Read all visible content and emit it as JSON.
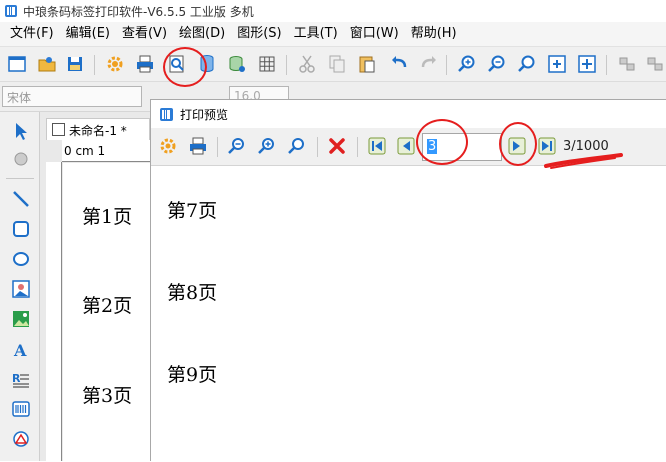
{
  "window": {
    "title": "中琅条码标签打印软件-V6.5.5 工业版 多机"
  },
  "menu": [
    "文件(F)",
    "编辑(E)",
    "查看(V)",
    "绘图(D)",
    "图形(S)",
    "工具(T)",
    "窗口(W)",
    "帮助(H)"
  ],
  "format_toolbar": {
    "font": "宋体",
    "size": "16.0"
  },
  "document": {
    "tab_label": "未命名-1 *",
    "ruler_label": "0 cm 1",
    "pages": [
      "第1页",
      "第2页",
      "第3页"
    ]
  },
  "preview": {
    "title": "打印预览",
    "page_input": "3",
    "page_count": "3/1000",
    "pages": [
      "第7页",
      "第8页",
      "第9页"
    ]
  },
  "colors": {
    "annotation": "#e51e1e",
    "icon_blue": "#1e6fc8",
    "icon_orange": "#f0a020",
    "close_red": "#e02020",
    "nav_green": "#2a9d4a"
  }
}
